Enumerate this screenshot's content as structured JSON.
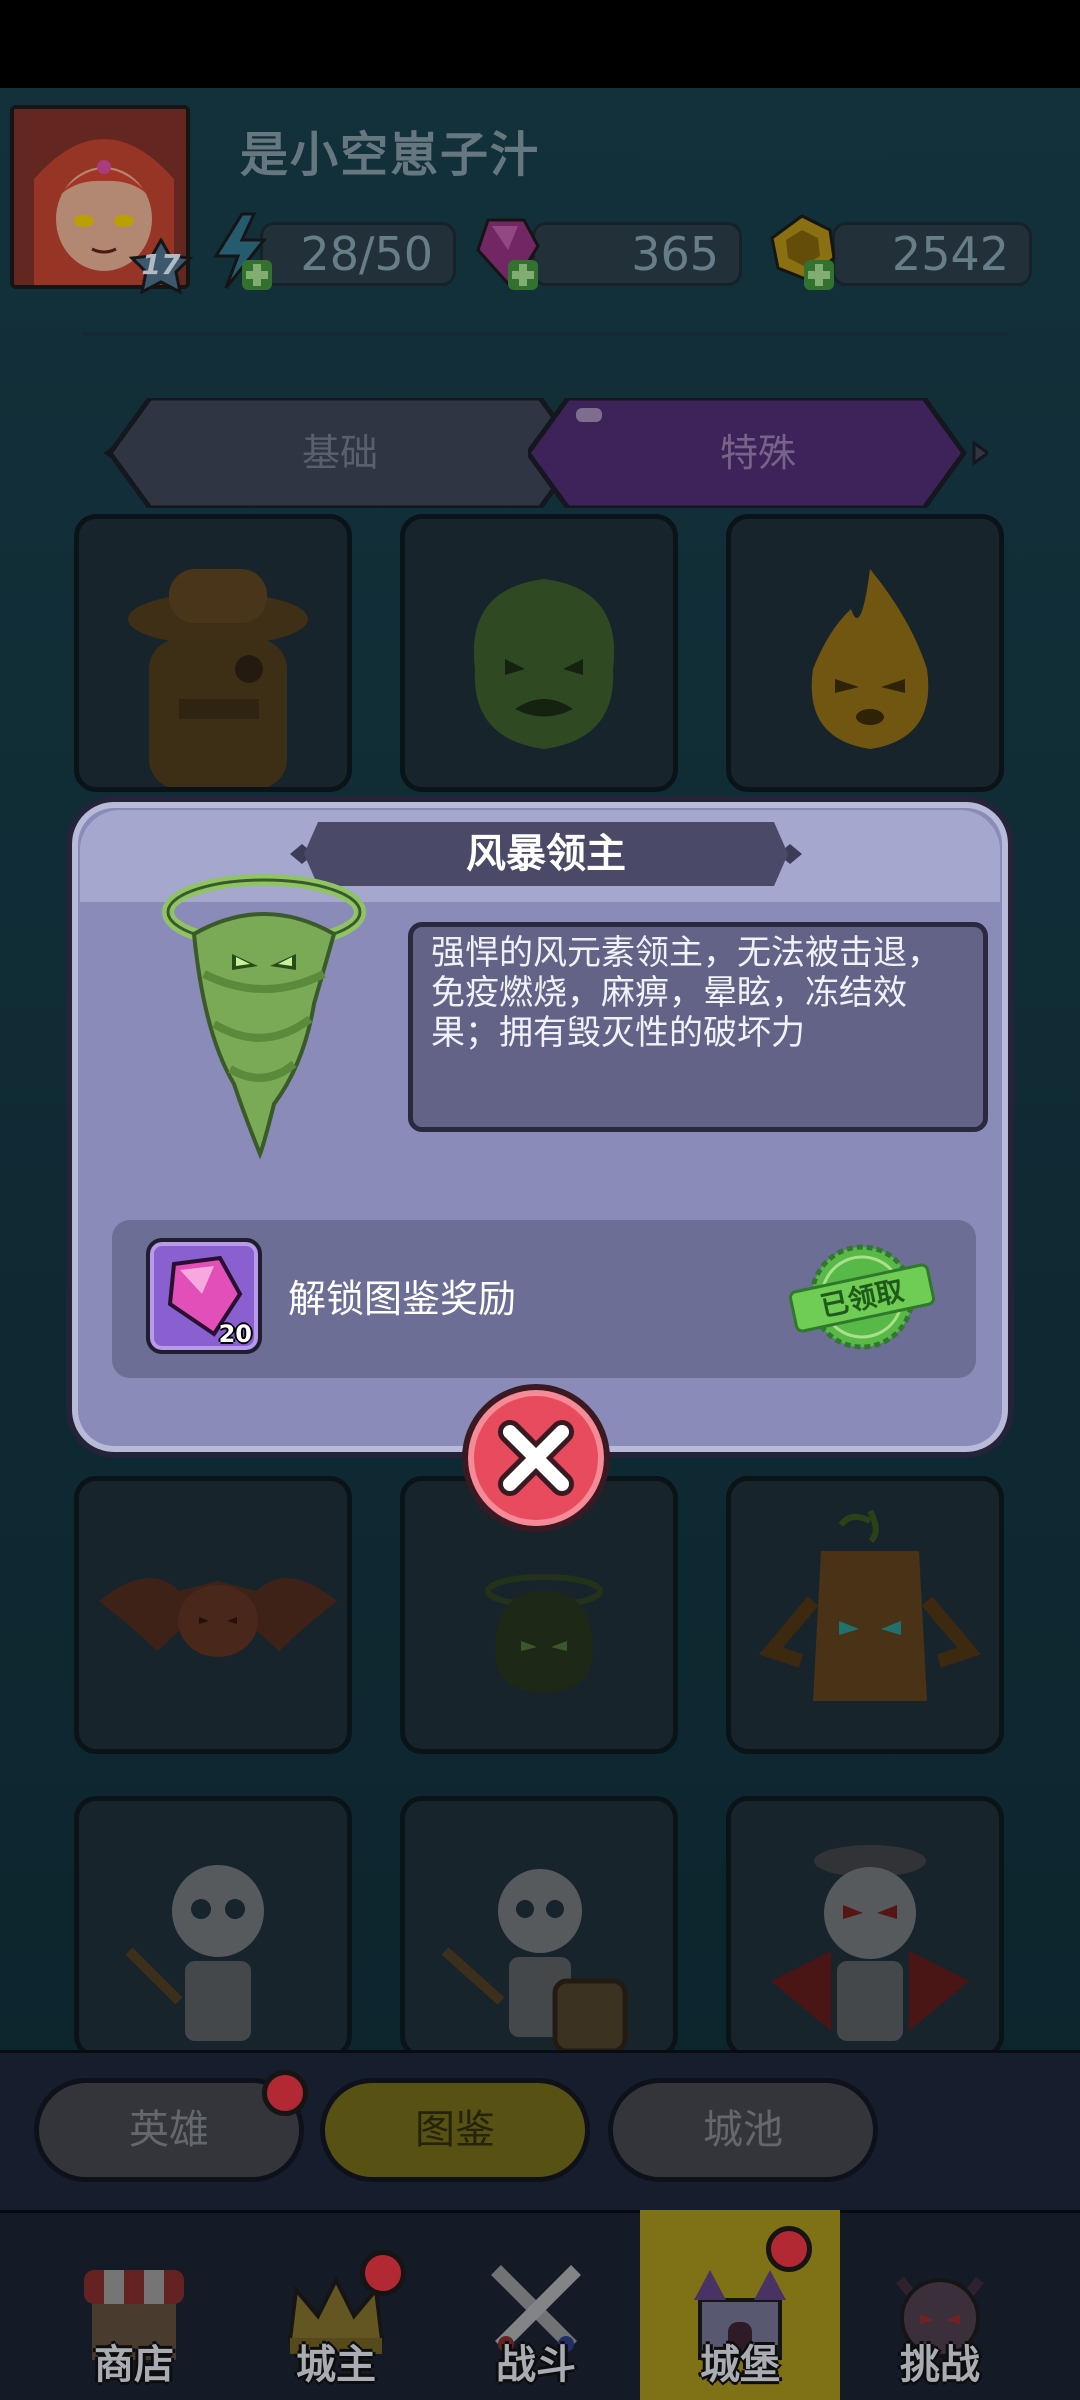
{
  "player": {
    "name": "是小空崽子汁",
    "level": "17"
  },
  "resources": {
    "energy": "28/50",
    "gems": "365",
    "coins": "2542"
  },
  "tabs": [
    {
      "label": "基础"
    },
    {
      "label": "特殊"
    }
  ],
  "grid": {
    "cards": [
      {
        "icon": "cowboy-monster-icon"
      },
      {
        "icon": "green-slime-icon"
      },
      {
        "icon": "fire-spirit-icon"
      },
      {
        "icon": "bat-icon"
      },
      {
        "icon": "dark-slime-icon"
      },
      {
        "icon": "treant-icon"
      },
      {
        "icon": "skeleton-icon"
      },
      {
        "icon": "skeleton-shield-icon"
      },
      {
        "icon": "skeleton-king-icon"
      }
    ]
  },
  "popup": {
    "title": "风暴领主",
    "description": "强悍的风元素领主，无法被击退，免疫燃烧，麻痹，晕眩，冻结效果；拥有毁灭性的破坏力",
    "reward": {
      "label": "解锁图鉴奖励",
      "count": "20",
      "status": "已领取"
    }
  },
  "subtabs": [
    {
      "label": "英雄",
      "badge": true
    },
    {
      "label": "图鉴",
      "active": true
    },
    {
      "label": "城池"
    }
  ],
  "nav": [
    {
      "label": "商店"
    },
    {
      "label": "城主",
      "badge": true
    },
    {
      "label": "战斗"
    },
    {
      "label": "城堡",
      "badge": true,
      "active": true
    },
    {
      "label": "挑战"
    }
  ],
  "colors": {
    "accent_purple": "#7a3fb0",
    "active_gold": "#c9b12a",
    "badge_red": "#d9313f",
    "claimed_green": "#58b848",
    "close_red": "#e94b5e"
  }
}
